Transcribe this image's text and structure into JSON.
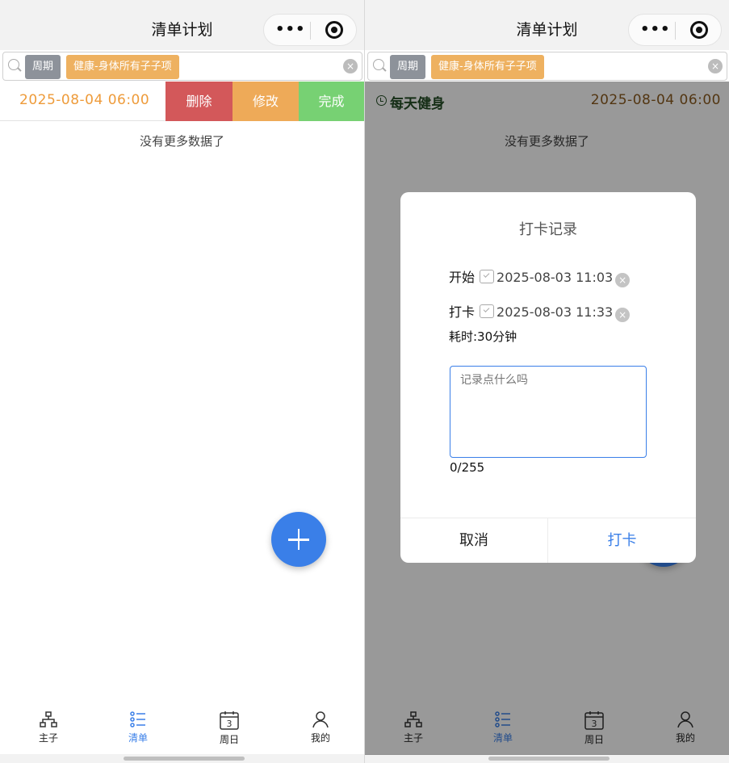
{
  "nav": {
    "title": "清单计划",
    "more_glyph": "•••"
  },
  "search": {
    "tag_period": "周期",
    "tag_category": "健康-身体所有子子项",
    "clear_glyph": "×"
  },
  "left": {
    "row": {
      "date": "2025-08-04 06:00"
    },
    "actions": {
      "delete": "删除",
      "edit": "修改",
      "done": "完成"
    },
    "no_more": "没有更多数据了"
  },
  "right": {
    "row": {
      "title": "每天健身",
      "date": "2025-08-04 06:00"
    },
    "no_more": "没有更多数据了",
    "modal": {
      "title": "打卡记录",
      "start_label": "开始",
      "start_time": "2025-08-03 11:03",
      "checkin_label": "打卡",
      "checkin_time": "2025-08-03 11:33",
      "duration": "耗时:30分钟",
      "note_placeholder": "记录点什么吗",
      "char_count": "0/255",
      "cancel_label": "取消",
      "confirm_label": "打卡"
    }
  },
  "tabbar": {
    "tabs": [
      {
        "label": "主子",
        "icon": "sitemap-icon"
      },
      {
        "label": "清单",
        "icon": "list-icon",
        "active": true
      },
      {
        "label": "周日",
        "icon": "calendar-icon",
        "day": "3"
      },
      {
        "label": "我的",
        "icon": "user-icon"
      }
    ]
  },
  "colors": {
    "accent": "#3a7fe8",
    "delete": "#d3585a",
    "edit": "#eeaa58",
    "done": "#77d173",
    "tag_period": "#8d929a",
    "tag_category": "#eeb160"
  }
}
